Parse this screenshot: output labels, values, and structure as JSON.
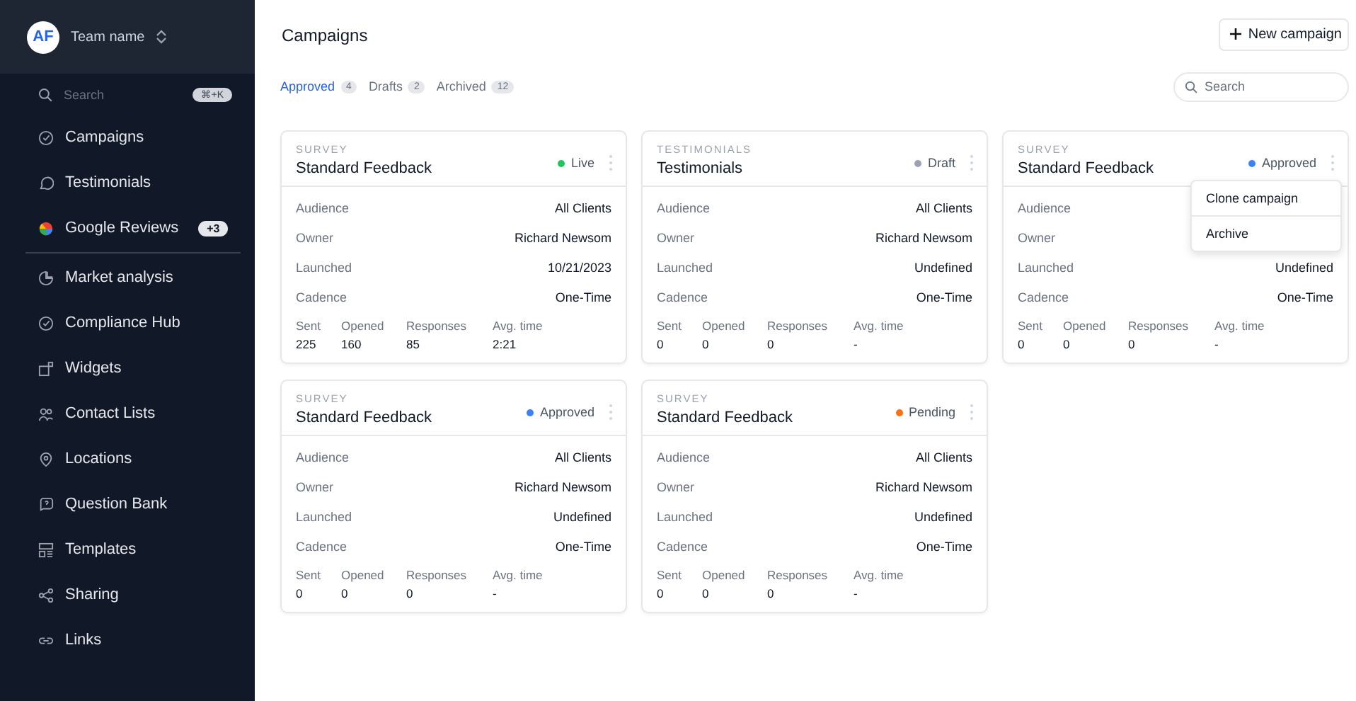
{
  "sidebar": {
    "avatar": "AF",
    "team": "Team name",
    "search": {
      "placeholder": "Search",
      "shortcut": "⌘+K"
    },
    "items": [
      {
        "label": "Campaigns"
      },
      {
        "label": "Testimonials"
      },
      {
        "label": "Google Reviews",
        "badge": "+3"
      },
      {
        "label": "Market analysis",
        "divider_before": true
      },
      {
        "label": "Compliance Hub"
      },
      {
        "label": "Widgets"
      },
      {
        "label": "Contact Lists"
      },
      {
        "label": "Locations"
      },
      {
        "label": "Question Bank"
      },
      {
        "label": "Templates"
      },
      {
        "label": "Sharing"
      },
      {
        "label": "Links"
      }
    ]
  },
  "header": {
    "title": "Campaigns",
    "new_button": "New campaign"
  },
  "tabs": [
    {
      "label": "Approved",
      "count": "4",
      "selected": true
    },
    {
      "label": "Drafts",
      "count": "2",
      "selected": false
    },
    {
      "label": "Archived",
      "count": "12",
      "selected": false
    }
  ],
  "search": {
    "placeholder": "Search"
  },
  "cards": [
    {
      "category": "SURVEY",
      "title": "Standard Feedback",
      "status": "Live",
      "color": "#22c55e",
      "fields": [
        {
          "label": "Audience",
          "value": "All Clients"
        },
        {
          "label": "Owner",
          "value": "Richard Newsom"
        },
        {
          "label": "Launched",
          "value": "10/21/2023"
        },
        {
          "label": "Cadence",
          "value": "One-Time"
        }
      ],
      "stats": [
        {
          "label": "Sent",
          "value": "225"
        },
        {
          "label": "Opened",
          "value": "160"
        },
        {
          "label": "Responses",
          "value": "85"
        },
        {
          "label": "Avg. time",
          "value": "2:21"
        }
      ]
    },
    {
      "category": "TESTIMONIALS",
      "title": "Testimonials",
      "status": "Draft",
      "color": "#9ca3af",
      "fields": [
        {
          "label": "Audience",
          "value": "All Clients"
        },
        {
          "label": "Owner",
          "value": "Richard Newsom"
        },
        {
          "label": "Launched",
          "value": "Undefined"
        },
        {
          "label": "Cadence",
          "value": "One-Time"
        }
      ],
      "stats": [
        {
          "label": "Sent",
          "value": "0"
        },
        {
          "label": "Opened",
          "value": "0"
        },
        {
          "label": "Responses",
          "value": "0"
        },
        {
          "label": "Avg. time",
          "value": "-"
        }
      ]
    },
    {
      "category": "SURVEY",
      "title": "Standard Feedback",
      "status": "Approved",
      "color": "#3b82f6",
      "fields": [
        {
          "label": "Audience"
        },
        {
          "label": "Owner"
        },
        {
          "label": "Launched",
          "value": "Undefined"
        },
        {
          "label": "Cadence",
          "value": "One-Time"
        }
      ],
      "stats": [
        {
          "label": "Sent",
          "value": "0"
        },
        {
          "label": "Opened",
          "value": "0"
        },
        {
          "label": "Responses",
          "value": "0"
        },
        {
          "label": "Avg. time",
          "value": "-"
        }
      ],
      "menu": [
        "Clone campaign",
        "Archive"
      ]
    },
    {
      "category": "SURVEY",
      "title": "Standard Feedback",
      "status": "Approved",
      "color": "#3b82f6",
      "fields": [
        {
          "label": "Audience",
          "value": "All Clients"
        },
        {
          "label": "Owner",
          "value": "Richard Newsom"
        },
        {
          "label": "Launched",
          "value": "Undefined"
        },
        {
          "label": "Cadence",
          "value": "One-Time"
        }
      ],
      "stats": [
        {
          "label": "Sent",
          "value": "0"
        },
        {
          "label": "Opened",
          "value": "0"
        },
        {
          "label": "Responses",
          "value": "0"
        },
        {
          "label": "Avg. time",
          "value": "-"
        }
      ]
    },
    {
      "category": "SURVEY",
      "title": "Standard Feedback",
      "status": "Pending",
      "color": "#f97316",
      "fields": [
        {
          "label": "Audience",
          "value": "All Clients"
        },
        {
          "label": "Owner",
          "value": "Richard Newsom"
        },
        {
          "label": "Launched",
          "value": "Undefined"
        },
        {
          "label": "Cadence",
          "value": "One-Time"
        }
      ],
      "stats": [
        {
          "label": "Sent",
          "value": "0"
        },
        {
          "label": "Opened",
          "value": "0"
        },
        {
          "label": "Responses",
          "value": "0"
        },
        {
          "label": "Avg. time",
          "value": "-"
        }
      ]
    }
  ]
}
